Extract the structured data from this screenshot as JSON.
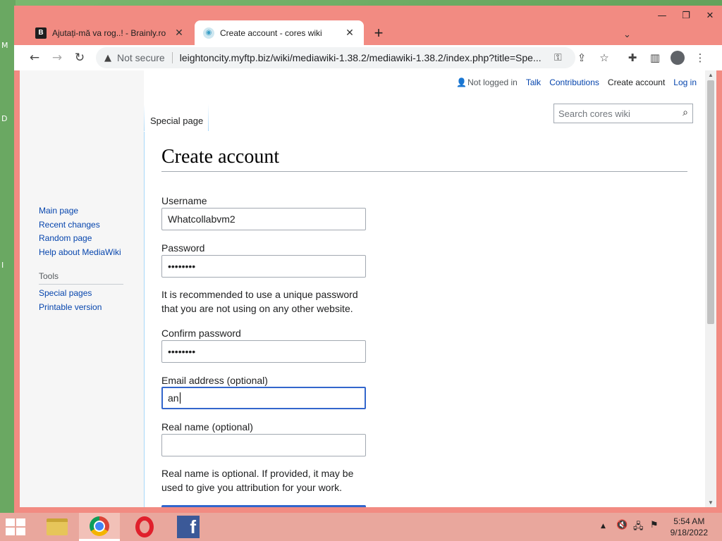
{
  "desktop": {
    "glyphs": [
      "M",
      "D",
      "I"
    ]
  },
  "tabs": [
    {
      "title": "Ajutați-mă va rog..! - Brainly.ro",
      "favicon": "brainly-icon"
    },
    {
      "title": "Create account - cores wiki",
      "favicon": "wiki-icon"
    }
  ],
  "toolbar": {
    "security_label": "Not secure",
    "url": "leightoncity.myftp.biz/wiki/mediawiki-1.38.2/mediawiki-1.38.2/index.php?title=Spe..."
  },
  "personal": {
    "not_logged_in": "Not logged in",
    "talk": "Talk",
    "contributions": "Contributions",
    "create_account": "Create account",
    "log_in": "Log in"
  },
  "page": {
    "tab_label": "Special page",
    "search_placeholder": "Search cores wiki",
    "title": "Create account"
  },
  "sidebar": {
    "nav": [
      "Main page",
      "Recent changes",
      "Random page",
      "Help about MediaWiki"
    ],
    "tools_heading": "Tools",
    "tools": [
      "Special pages",
      "Printable version"
    ]
  },
  "form": {
    "username_label": "Username",
    "username_value": "Whatcollabvm2",
    "password_label": "Password",
    "password_value": "••••••••",
    "password_help": "It is recommended to use a unique password that you are not using on any other website.",
    "confirm_label": "Confirm password",
    "confirm_value": "••••••••",
    "email_label": "Email address (optional)",
    "email_value": "an",
    "realname_label": "Real name (optional)",
    "realname_value": "",
    "realname_help": "Real name is optional. If provided, it may be used to give you attribution for your work."
  },
  "taskbar": {
    "apps": [
      "file-explorer-icon",
      "chrome-icon",
      "opera-icon",
      "facebook-icon"
    ],
    "time": "5:54 AM",
    "date": "9/18/2022"
  },
  "colors": {
    "window_frame": "#f28b82",
    "link": "#0645ad",
    "focus_border": "#3366cc",
    "taskbar": "#e9a79d"
  }
}
